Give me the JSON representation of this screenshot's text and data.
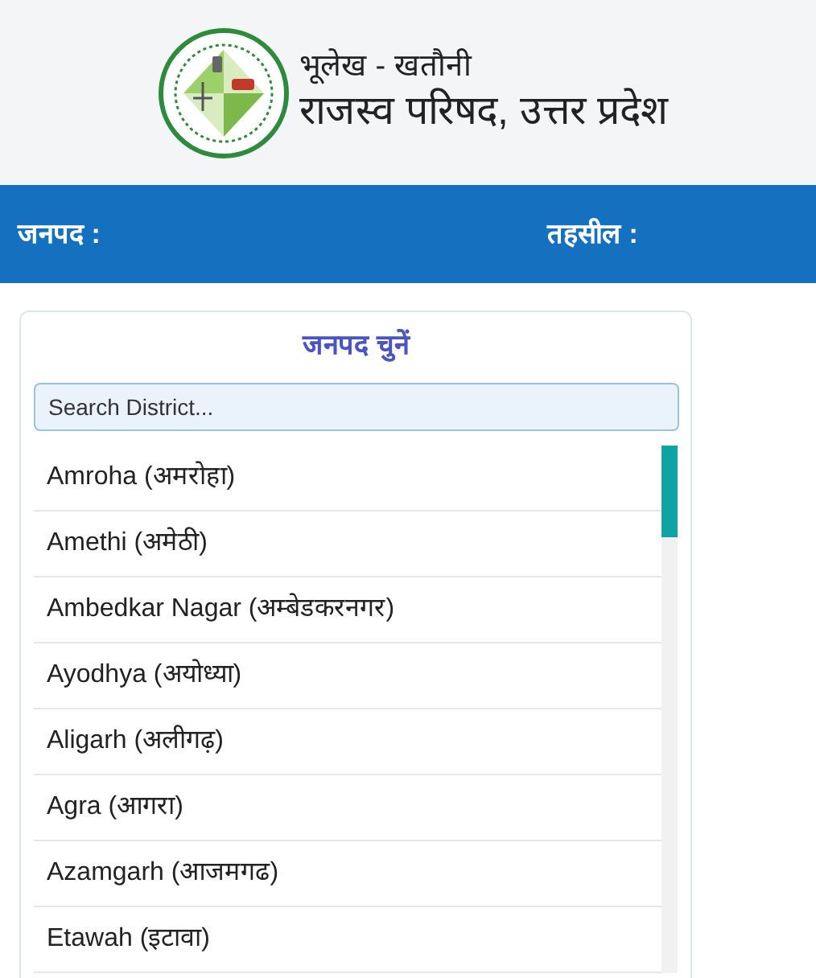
{
  "header": {
    "subtitle": "भूलेख - खतौनी",
    "title": "राजस्व परिषद, उत्तर प्रदेश"
  },
  "nav_bar": {
    "district_label": "जनपद :",
    "tehsil_label": "तहसील :"
  },
  "district_panel": {
    "heading": "जनपद चुनें",
    "search": {
      "placeholder": "Search District..."
    },
    "items": [
      "Amroha (अमरोहा)",
      "Amethi (अमेठी)",
      "Ambedkar Nagar (अम्बेडकरनगर)",
      "Ayodhya (अयोध्या)",
      "Aligarh (अलीगढ़)",
      "Agra (आगरा)",
      "Azamgarh (आजमगढ)",
      "Etawah (इटावा)"
    ]
  }
}
